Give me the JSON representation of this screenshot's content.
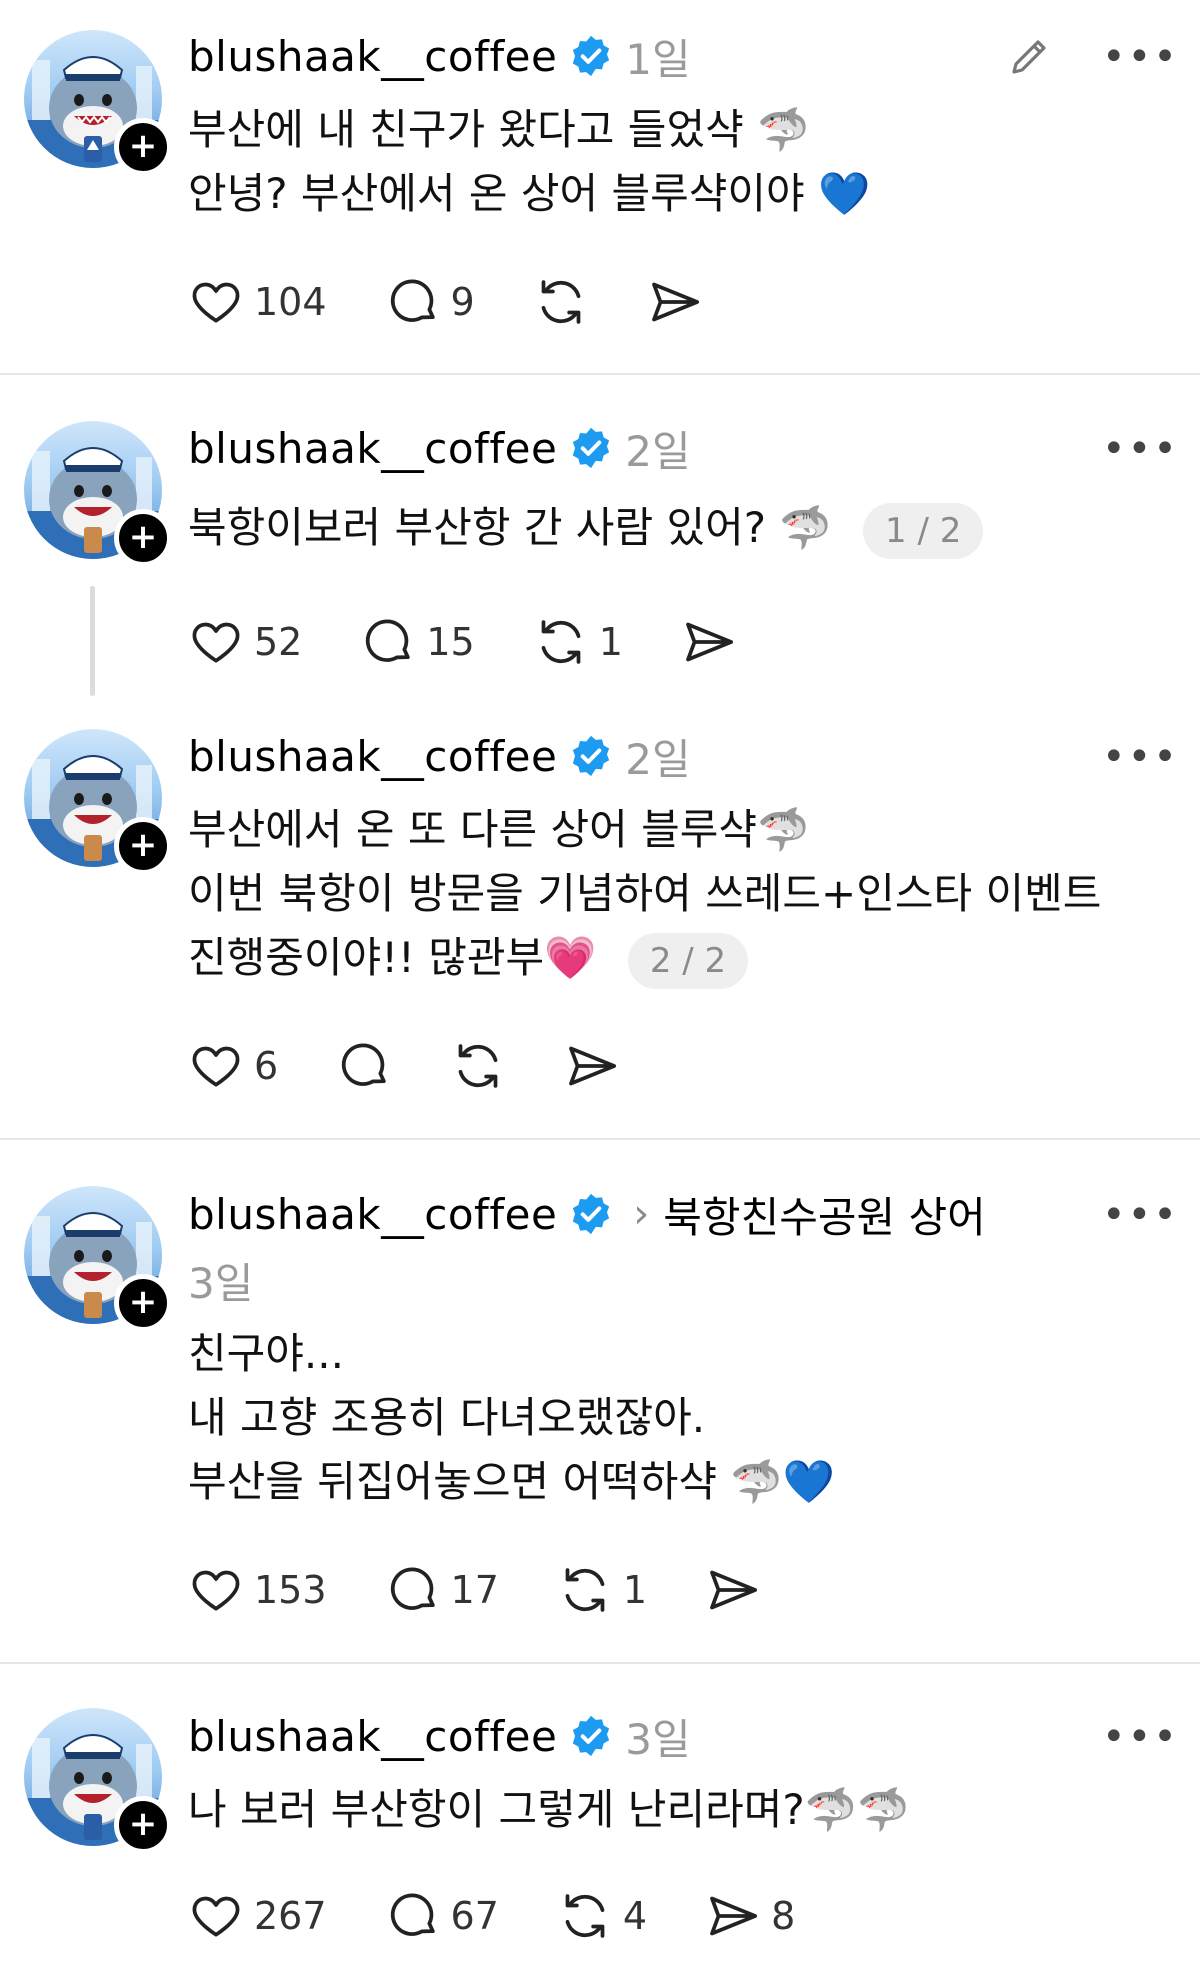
{
  "posts": [
    {
      "username": "blushaak__coffee",
      "time": "1일",
      "lines": [
        "부산에 내 친구가 왔다고 들었샥 🦈",
        "안녕? 부산에서 온 상어 블루샥이야 💙"
      ],
      "pill": "",
      "topic": "",
      "likes": "104",
      "replies": "9",
      "reposts": "",
      "shares": ""
    },
    {
      "username": "blushaak__coffee",
      "time": "2일",
      "lines": [
        "북항이보러 부산항 간 사람 있어? 🦈"
      ],
      "pill": "1 / 2",
      "topic": "",
      "likes": "52",
      "replies": "15",
      "reposts": "1",
      "shares": ""
    },
    {
      "username": "blushaak__coffee",
      "time": "2일",
      "lines": [
        "부산에서 온 또 다른 상어 블루샥🦈",
        "이번 북항이 방문을 기념하여 쓰레드+인스타 이벤트",
        "진행중이야!! 많관부💗"
      ],
      "pill": "2 / 2",
      "topic": "",
      "likes": "6",
      "replies": "",
      "reposts": "",
      "shares": ""
    },
    {
      "username": "blushaak__coffee",
      "time": "3일",
      "lines": [
        "친구야...",
        "내 고향 조용히 다녀오랬잖아.",
        "부산을 뒤집어놓으면 어떡하샥 🦈💙"
      ],
      "pill": "",
      "topic": "북항친수공원 상어",
      "likes": "153",
      "replies": "17",
      "reposts": "1",
      "shares": ""
    },
    {
      "username": "blushaak__coffee",
      "time": "3일",
      "lines": [
        "나 보러 부산항이 그렇게 난리라며?🦈🦈"
      ],
      "pill": "",
      "topic": "",
      "likes": "267",
      "replies": "67",
      "reposts": "4",
      "shares": "8"
    }
  ],
  "icons": {
    "more": "more-horizontal-icon",
    "edit": "pencil-icon",
    "verified": "verified-badge-icon",
    "like": "heart-icon",
    "reply": "comment-icon",
    "repost": "repost-icon",
    "share": "send-icon",
    "follow": "plus-icon"
  },
  "ui": {
    "more_glyph": "•••",
    "plus_glyph": "+",
    "chevron_glyph": "›"
  },
  "colors": {
    "verified": "#1d9bf0",
    "divider": "#e6e6e6",
    "meta": "#9a9a9a"
  }
}
